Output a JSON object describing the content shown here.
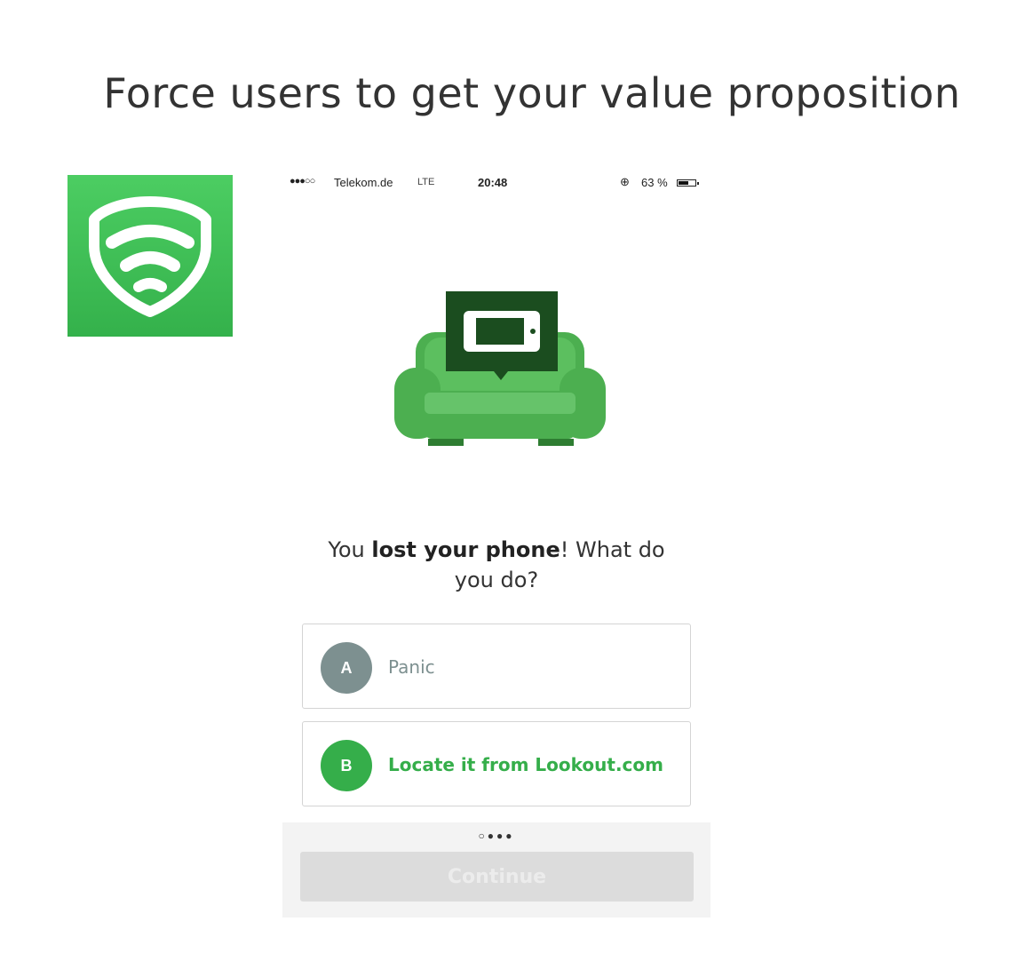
{
  "slide": {
    "title": "Force users to get your value proposition"
  },
  "app_icon": {
    "name": "shield-wifi-icon",
    "color": "#3dbd55"
  },
  "status_bar": {
    "signal": "●●●○○",
    "carrier": "Telekom.de",
    "network": "LTE",
    "time": "20:48",
    "rotation_lock_icon": "⊕",
    "battery": "63 %",
    "battery_level": 0.63
  },
  "illustration": {
    "name": "sofa-with-phone-illustration"
  },
  "question": {
    "prefix": "You ",
    "bold": "lost your phone",
    "suffix": "! What do you do?"
  },
  "options": [
    {
      "letter": "A",
      "label": "Panic",
      "color": "#7d9090"
    },
    {
      "letter": "B",
      "label": "Locate it from Lookout.com",
      "color": "#35ae4a"
    }
  ],
  "pager": {
    "text": "○●●●",
    "current": 1,
    "total": 4
  },
  "continue_button": {
    "label": "Continue",
    "enabled": false
  }
}
